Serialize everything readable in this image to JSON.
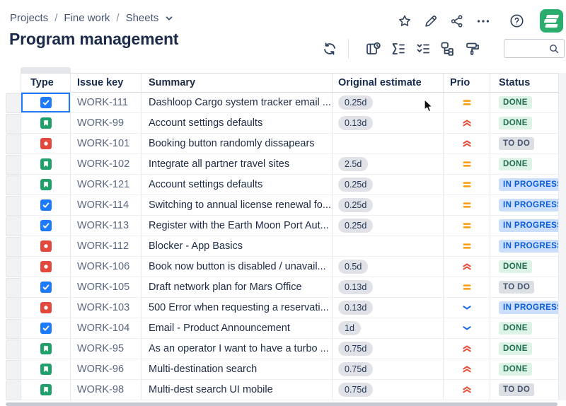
{
  "breadcrumb": {
    "items": [
      "Projects",
      "Fine work",
      "Sheets"
    ],
    "separator": "/"
  },
  "title": "Program management",
  "top_actions": {
    "icons": [
      "star-icon",
      "edit-icon",
      "share-icon",
      "more-icon",
      "help-icon",
      "app-logo"
    ]
  },
  "toolbar": {
    "icons": [
      "refresh-icon",
      "details-clock-icon",
      "sum-list-icon",
      "checklist-icon",
      "hierarchy-icon",
      "paint-roller-icon"
    ],
    "search": {
      "value": "",
      "placeholder": ""
    }
  },
  "table": {
    "columns": [
      "Type",
      "Issue key",
      "Summary",
      "Original estimate",
      "Prio",
      "Status"
    ],
    "selected_cell": {
      "row_key": "WORK-111",
      "column": "Type"
    },
    "rows": [
      {
        "type": "task",
        "key": "WORK-111",
        "summary": "Dashloop Cargo system tracker email ...",
        "estimate": "0.25d",
        "priority": "medium",
        "status": "DONE"
      },
      {
        "type": "story",
        "key": "WORK-99",
        "summary": "Account settings defaults",
        "estimate": "0.13d",
        "priority": "high",
        "status": "DONE"
      },
      {
        "type": "bug",
        "key": "WORK-101",
        "summary": "Booking button randomly dissapears",
        "estimate": "",
        "priority": "high",
        "status": "TO DO"
      },
      {
        "type": "story",
        "key": "WORK-102",
        "summary": "Integrate all partner travel sites",
        "estimate": "2.5d",
        "priority": "medium",
        "status": "DONE"
      },
      {
        "type": "story",
        "key": "WORK-121",
        "summary": "Account settings defaults",
        "estimate": "0.25d",
        "priority": "medium",
        "status": "IN PROGRESS"
      },
      {
        "type": "task",
        "key": "WORK-114",
        "summary": "Switching to annual license renewal fo...",
        "estimate": "0.25d",
        "priority": "medium",
        "status": "IN PROGRESS"
      },
      {
        "type": "task",
        "key": "WORK-113",
        "summary": "Register with the Earth Moon Port Aut...",
        "estimate": "0.25d",
        "priority": "medium",
        "status": "IN PROGRESS"
      },
      {
        "type": "bug",
        "key": "WORK-112",
        "summary": "Blocker - App Basics",
        "estimate": "",
        "priority": "medium",
        "status": "IN PROGRESS"
      },
      {
        "type": "bug",
        "key": "WORK-106",
        "summary": "Book now button is disabled / unavail...",
        "estimate": "0.5d",
        "priority": "high",
        "status": "DONE"
      },
      {
        "type": "task",
        "key": "WORK-105",
        "summary": "Draft network plan for Mars Office",
        "estimate": "0.13d",
        "priority": "medium",
        "status": "TO DO"
      },
      {
        "type": "bug",
        "key": "WORK-103",
        "summary": "500 Error when requesting a reservati...",
        "estimate": "0.13d",
        "priority": "low",
        "status": "IN PROGRESS"
      },
      {
        "type": "task",
        "key": "WORK-104",
        "summary": "Email - Product Announcement",
        "estimate": "1d",
        "priority": "low",
        "status": "DONE"
      },
      {
        "type": "story",
        "key": "WORK-95",
        "summary": "As an operator I want to have a turbo ...",
        "estimate": "0.75d",
        "priority": "high",
        "status": "DONE"
      },
      {
        "type": "story",
        "key": "WORK-96",
        "summary": "Multi-destination search",
        "estimate": "0.75d",
        "priority": "high",
        "status": "DONE"
      },
      {
        "type": "story",
        "key": "WORK-98",
        "summary": "Multi-dest search UI mobile",
        "estimate": "0.75d",
        "priority": "high",
        "status": "TO DO"
      }
    ]
  },
  "colors": {
    "accent_blue": "#1D7AFC",
    "task_blue": "#1D7AFC",
    "story_green": "#22A06B",
    "bug_red": "#E2483D",
    "priority_medium_orange": "#FB9B0C",
    "priority_high_red": "#E8503C",
    "priority_low_blue": "#1D6AE5",
    "status_done_bg": "#DCF3E6",
    "status_done_text": "#1F6E4E",
    "status_todo_bg": "#DCDFE4",
    "status_todo_text": "#44546F",
    "status_inprogress_bg": "#CBDFFC",
    "status_inprogress_text": "#0B5CD7",
    "logo_green": "#2BAD6E"
  }
}
